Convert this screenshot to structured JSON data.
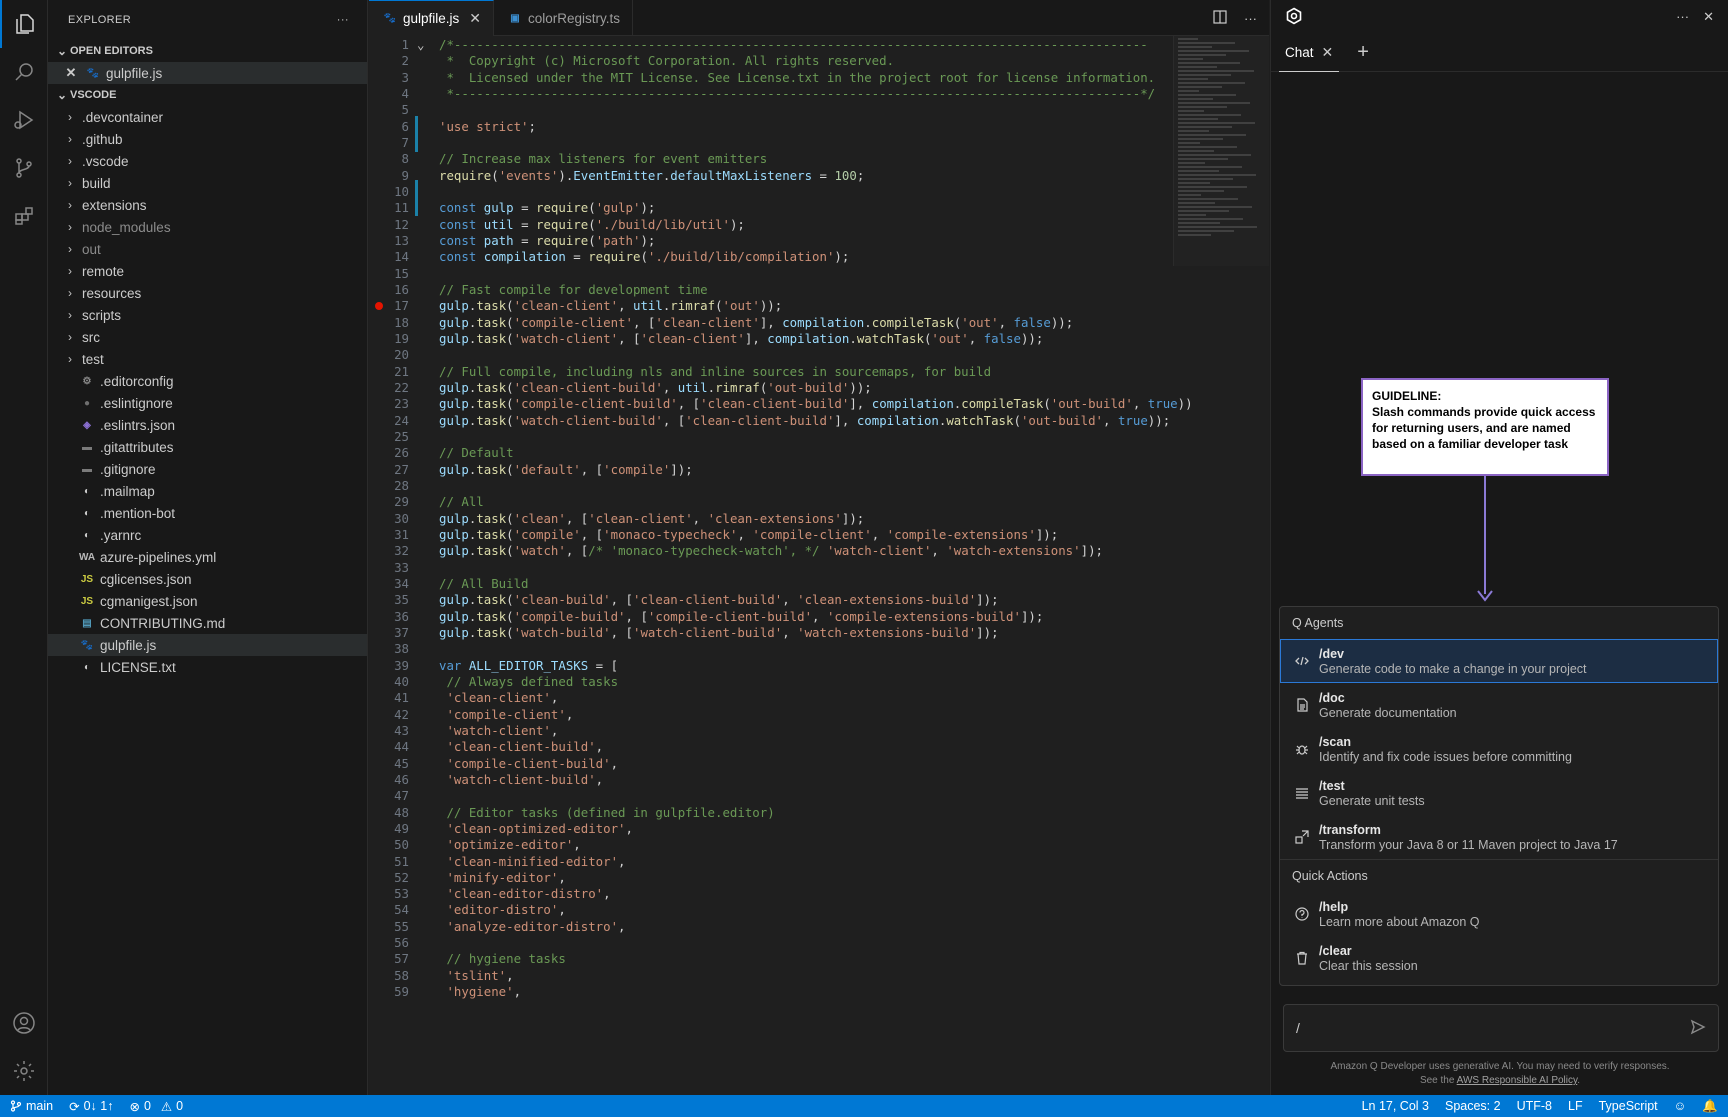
{
  "sidebar": {
    "title": "EXPLORER",
    "more": "···",
    "open_editors_label": "OPEN EDITORS",
    "open_editor_file": "gulpfile.js",
    "workspace_label": "VSCODE",
    "folders": [
      ".devcontainer",
      ".github",
      ".vscode",
      "build",
      "extensions",
      "node_modules",
      "out",
      "remote",
      "resources",
      "scripts",
      "src",
      "test"
    ],
    "files": [
      {
        "name": ".editorconfig",
        "icon": "gear-icon"
      },
      {
        "name": ".eslintignore",
        "icon": "circle-icon"
      },
      {
        "name": ".eslintrs.json",
        "icon": "eslint-icon"
      },
      {
        "name": ".gitattributes",
        "icon": "folder-icon"
      },
      {
        "name": ".gitignore",
        "icon": "folder-icon"
      },
      {
        "name": ".mailmap",
        "icon": "git-icon"
      },
      {
        "name": ".mention-bot",
        "icon": "git-icon"
      },
      {
        "name": ".yarnrc",
        "icon": "git-icon"
      },
      {
        "name": "azure-pipelines.yml",
        "icon": "wa-icon"
      },
      {
        "name": "cglicenses.json",
        "icon": "json-icon"
      },
      {
        "name": "cgmanigest.json",
        "icon": "json-icon"
      },
      {
        "name": "CONTRIBUTING.md",
        "icon": "markdown-icon"
      },
      {
        "name": "gulpfile.js",
        "icon": "gulp-icon"
      },
      {
        "name": "LICENSE.txt",
        "icon": "git-icon"
      }
    ]
  },
  "tabs": [
    {
      "label": "gulpfile.js",
      "active": true
    },
    {
      "label": "colorRegistry.ts",
      "active": false
    }
  ],
  "editor": {
    "lines": [
      [
        [
          "c-com",
          "/*---------------------------------------------------------------------------------------------"
        ]
      ],
      [
        [
          "c-com",
          " *  Copyright (c) Microsoft Corporation. All rights reserved."
        ]
      ],
      [
        [
          "c-com",
          " *  Licensed under the MIT License. See License.txt in the project root for license information."
        ]
      ],
      [
        [
          "c-com",
          " *--------------------------------------------------------------------------------------------*/"
        ]
      ],
      [],
      [
        [
          "c-str",
          "'use strict'"
        ],
        [
          "c-pl",
          ";"
        ]
      ],
      [],
      [
        [
          "c-com",
          "// Increase max listeners for event emitters"
        ]
      ],
      [
        [
          "c-fn",
          "require"
        ],
        [
          "c-pl",
          "("
        ],
        [
          "c-str",
          "'events'"
        ],
        [
          "c-pl",
          ")."
        ],
        [
          "c-id",
          "EventEmitter"
        ],
        [
          "c-pl",
          "."
        ],
        [
          "c-id",
          "defaultMaxListeners"
        ],
        [
          "c-pl",
          " = "
        ],
        [
          "c-num",
          "100"
        ],
        [
          "c-pl",
          ";"
        ]
      ],
      [],
      [
        [
          "c-kw",
          "const "
        ],
        [
          "c-id",
          "gulp"
        ],
        [
          "c-pl",
          " = "
        ],
        [
          "c-fn",
          "require"
        ],
        [
          "c-pl",
          "("
        ],
        [
          "c-str",
          "'gulp'"
        ],
        [
          "c-pl",
          ");"
        ]
      ],
      [
        [
          "c-kw",
          "const "
        ],
        [
          "c-id",
          "util"
        ],
        [
          "c-pl",
          " = "
        ],
        [
          "c-fn",
          "require"
        ],
        [
          "c-pl",
          "("
        ],
        [
          "c-str",
          "'./build/lib/util'"
        ],
        [
          "c-pl",
          ");"
        ]
      ],
      [
        [
          "c-kw",
          "const "
        ],
        [
          "c-id",
          "path"
        ],
        [
          "c-pl",
          " = "
        ],
        [
          "c-fn",
          "require"
        ],
        [
          "c-pl",
          "("
        ],
        [
          "c-str",
          "'path'"
        ],
        [
          "c-pl",
          ");"
        ]
      ],
      [
        [
          "c-kw",
          "const "
        ],
        [
          "c-id",
          "compilation"
        ],
        [
          "c-pl",
          " = "
        ],
        [
          "c-fn",
          "require"
        ],
        [
          "c-pl",
          "("
        ],
        [
          "c-str",
          "'./build/lib/compilation'"
        ],
        [
          "c-pl",
          ");"
        ]
      ],
      [],
      [
        [
          "c-com",
          "// Fast compile for development time"
        ]
      ],
      [
        [
          "c-id",
          "gulp"
        ],
        [
          "c-pl",
          "."
        ],
        [
          "c-fn",
          "task"
        ],
        [
          "c-pl",
          "("
        ],
        [
          "c-str",
          "'clean-client'"
        ],
        [
          "c-pl",
          ", "
        ],
        [
          "c-id",
          "util"
        ],
        [
          "c-pl",
          "."
        ],
        [
          "c-fn",
          "rimraf"
        ],
        [
          "c-pl",
          "("
        ],
        [
          "c-str",
          "'out'"
        ],
        [
          "c-pl",
          "));"
        ]
      ],
      [
        [
          "c-id",
          "gulp"
        ],
        [
          "c-pl",
          "."
        ],
        [
          "c-fn",
          "task"
        ],
        [
          "c-pl",
          "("
        ],
        [
          "c-str",
          "'compile-client'"
        ],
        [
          "c-pl",
          ", ["
        ],
        [
          "c-str",
          "'clean-client'"
        ],
        [
          "c-pl",
          "], "
        ],
        [
          "c-id",
          "compilation"
        ],
        [
          "c-pl",
          "."
        ],
        [
          "c-fn",
          "compileTask"
        ],
        [
          "c-pl",
          "("
        ],
        [
          "c-str",
          "'out'"
        ],
        [
          "c-pl",
          ", "
        ],
        [
          "c-kw",
          "false"
        ],
        [
          "c-pl",
          "));"
        ]
      ],
      [
        [
          "c-id",
          "gulp"
        ],
        [
          "c-pl",
          "."
        ],
        [
          "c-fn",
          "task"
        ],
        [
          "c-pl",
          "("
        ],
        [
          "c-str",
          "'watch-client'"
        ],
        [
          "c-pl",
          ", ["
        ],
        [
          "c-str",
          "'clean-client'"
        ],
        [
          "c-pl",
          "], "
        ],
        [
          "c-id",
          "compilation"
        ],
        [
          "c-pl",
          "."
        ],
        [
          "c-fn",
          "watchTask"
        ],
        [
          "c-pl",
          "("
        ],
        [
          "c-str",
          "'out'"
        ],
        [
          "c-pl",
          ", "
        ],
        [
          "c-kw",
          "false"
        ],
        [
          "c-pl",
          "));"
        ]
      ],
      [],
      [
        [
          "c-com",
          "// Full compile, including nls and inline sources in sourcemaps, for build"
        ]
      ],
      [
        [
          "c-id",
          "gulp"
        ],
        [
          "c-pl",
          "."
        ],
        [
          "c-fn",
          "task"
        ],
        [
          "c-pl",
          "("
        ],
        [
          "c-str",
          "'clean-client-build'"
        ],
        [
          "c-pl",
          ", "
        ],
        [
          "c-id",
          "util"
        ],
        [
          "c-pl",
          "."
        ],
        [
          "c-fn",
          "rimraf"
        ],
        [
          "c-pl",
          "("
        ],
        [
          "c-str",
          "'out-build'"
        ],
        [
          "c-pl",
          "));"
        ]
      ],
      [
        [
          "c-id",
          "gulp"
        ],
        [
          "c-pl",
          "."
        ],
        [
          "c-fn",
          "task"
        ],
        [
          "c-pl",
          "("
        ],
        [
          "c-str",
          "'compile-client-build'"
        ],
        [
          "c-pl",
          ", ["
        ],
        [
          "c-str",
          "'clean-client-build'"
        ],
        [
          "c-pl",
          "], "
        ],
        [
          "c-id",
          "compilation"
        ],
        [
          "c-pl",
          "."
        ],
        [
          "c-fn",
          "compileTask"
        ],
        [
          "c-pl",
          "("
        ],
        [
          "c-str",
          "'out-build'"
        ],
        [
          "c-pl",
          ", "
        ],
        [
          "c-kw",
          "true"
        ],
        [
          "c-pl",
          "))"
        ]
      ],
      [
        [
          "c-id",
          "gulp"
        ],
        [
          "c-pl",
          "."
        ],
        [
          "c-fn",
          "task"
        ],
        [
          "c-pl",
          "("
        ],
        [
          "c-str",
          "'watch-client-build'"
        ],
        [
          "c-pl",
          ", ["
        ],
        [
          "c-str",
          "'clean-client-build'"
        ],
        [
          "c-pl",
          "], "
        ],
        [
          "c-id",
          "compilation"
        ],
        [
          "c-pl",
          "."
        ],
        [
          "c-fn",
          "watchTask"
        ],
        [
          "c-pl",
          "("
        ],
        [
          "c-str",
          "'out-build'"
        ],
        [
          "c-pl",
          ", "
        ],
        [
          "c-kw",
          "true"
        ],
        [
          "c-pl",
          "));"
        ]
      ],
      [],
      [
        [
          "c-com",
          "// Default"
        ]
      ],
      [
        [
          "c-id",
          "gulp"
        ],
        [
          "c-pl",
          "."
        ],
        [
          "c-fn",
          "task"
        ],
        [
          "c-pl",
          "("
        ],
        [
          "c-str",
          "'default'"
        ],
        [
          "c-pl",
          ", ["
        ],
        [
          "c-str",
          "'compile'"
        ],
        [
          "c-pl",
          "]);"
        ]
      ],
      [],
      [
        [
          "c-com",
          "// All"
        ]
      ],
      [
        [
          "c-id",
          "gulp"
        ],
        [
          "c-pl",
          "."
        ],
        [
          "c-fn",
          "task"
        ],
        [
          "c-pl",
          "("
        ],
        [
          "c-str",
          "'clean'"
        ],
        [
          "c-pl",
          ", ["
        ],
        [
          "c-str",
          "'clean-client'"
        ],
        [
          "c-pl",
          ", "
        ],
        [
          "c-str",
          "'clean-extensions'"
        ],
        [
          "c-pl",
          "]);"
        ]
      ],
      [
        [
          "c-id",
          "gulp"
        ],
        [
          "c-pl",
          "."
        ],
        [
          "c-fn",
          "task"
        ],
        [
          "c-pl",
          "("
        ],
        [
          "c-str",
          "'compile'"
        ],
        [
          "c-pl",
          ", ["
        ],
        [
          "c-str",
          "'monaco-typecheck'"
        ],
        [
          "c-pl",
          ", "
        ],
        [
          "c-str",
          "'compile-client'"
        ],
        [
          "c-pl",
          ", "
        ],
        [
          "c-str",
          "'compile-extensions'"
        ],
        [
          "c-pl",
          "]);"
        ]
      ],
      [
        [
          "c-id",
          "gulp"
        ],
        [
          "c-pl",
          "."
        ],
        [
          "c-fn",
          "task"
        ],
        [
          "c-pl",
          "("
        ],
        [
          "c-str",
          "'watch'"
        ],
        [
          "c-pl",
          ", ["
        ],
        [
          "c-com",
          "/* 'monaco-typecheck-watch', */"
        ],
        [
          "c-pl",
          " "
        ],
        [
          "c-str",
          "'watch-client'"
        ],
        [
          "c-pl",
          ", "
        ],
        [
          "c-str",
          "'watch-extensions'"
        ],
        [
          "c-pl",
          "]);"
        ]
      ],
      [],
      [
        [
          "c-com",
          "// All Build"
        ]
      ],
      [
        [
          "c-id",
          "gulp"
        ],
        [
          "c-pl",
          "."
        ],
        [
          "c-fn",
          "task"
        ],
        [
          "c-pl",
          "("
        ],
        [
          "c-str",
          "'clean-build'"
        ],
        [
          "c-pl",
          ", ["
        ],
        [
          "c-str",
          "'clean-client-build'"
        ],
        [
          "c-pl",
          ", "
        ],
        [
          "c-str",
          "'clean-extensions-build'"
        ],
        [
          "c-pl",
          "]);"
        ]
      ],
      [
        [
          "c-id",
          "gulp"
        ],
        [
          "c-pl",
          "."
        ],
        [
          "c-fn",
          "task"
        ],
        [
          "c-pl",
          "("
        ],
        [
          "c-str",
          "'compile-build'"
        ],
        [
          "c-pl",
          ", ["
        ],
        [
          "c-str",
          "'compile-client-build'"
        ],
        [
          "c-pl",
          ", "
        ],
        [
          "c-str",
          "'compile-extensions-build'"
        ],
        [
          "c-pl",
          "]);"
        ]
      ],
      [
        [
          "c-id",
          "gulp"
        ],
        [
          "c-pl",
          "."
        ],
        [
          "c-fn",
          "task"
        ],
        [
          "c-pl",
          "("
        ],
        [
          "c-str",
          "'watch-build'"
        ],
        [
          "c-pl",
          ", ["
        ],
        [
          "c-str",
          "'watch-client-build'"
        ],
        [
          "c-pl",
          ", "
        ],
        [
          "c-str",
          "'watch-extensions-build'"
        ],
        [
          "c-pl",
          "]);"
        ]
      ],
      [],
      [
        [
          "c-kw",
          "var "
        ],
        [
          "c-id",
          "ALL_EDITOR_TASKS"
        ],
        [
          "c-pl",
          " = ["
        ]
      ],
      [
        [
          "c-com",
          " // Always defined tasks"
        ]
      ],
      [
        [
          "c-str",
          " 'clean-client'"
        ],
        [
          "c-pl",
          ","
        ]
      ],
      [
        [
          "c-str",
          " 'compile-client'"
        ],
        [
          "c-pl",
          ","
        ]
      ],
      [
        [
          "c-str",
          " 'watch-client'"
        ],
        [
          "c-pl",
          ","
        ]
      ],
      [
        [
          "c-str",
          " 'clean-client-build'"
        ],
        [
          "c-pl",
          ","
        ]
      ],
      [
        [
          "c-str",
          " 'compile-client-build'"
        ],
        [
          "c-pl",
          ","
        ]
      ],
      [
        [
          "c-str",
          " 'watch-client-build'"
        ],
        [
          "c-pl",
          ","
        ]
      ],
      [],
      [
        [
          "c-com",
          " // Editor tasks (defined in gulpfile.editor)"
        ]
      ],
      [
        [
          "c-str",
          " 'clean-optimized-editor'"
        ],
        [
          "c-pl",
          ","
        ]
      ],
      [
        [
          "c-str",
          " 'optimize-editor'"
        ],
        [
          "c-pl",
          ","
        ]
      ],
      [
        [
          "c-str",
          " 'clean-minified-editor'"
        ],
        [
          "c-pl",
          ","
        ]
      ],
      [
        [
          "c-str",
          " 'minify-editor'"
        ],
        [
          "c-pl",
          ","
        ]
      ],
      [
        [
          "c-str",
          " 'clean-editor-distro'"
        ],
        [
          "c-pl",
          ","
        ]
      ],
      [
        [
          "c-str",
          " 'editor-distro'"
        ],
        [
          "c-pl",
          ","
        ]
      ],
      [
        [
          "c-str",
          " 'analyze-editor-distro'"
        ],
        [
          "c-pl",
          ","
        ]
      ],
      [],
      [
        [
          "c-com",
          " // hygiene tasks"
        ]
      ],
      [
        [
          "c-str",
          " 'tslint'"
        ],
        [
          "c-pl",
          ","
        ]
      ],
      [
        [
          "c-str",
          " 'hygiene'"
        ],
        [
          "c-pl",
          ","
        ]
      ]
    ]
  },
  "chat": {
    "tab_label": "Chat",
    "plus": "+",
    "more": "···",
    "guideline_title": "GUIDELINE:",
    "guideline_text": "Slash commands provide quick access for returning users, and are named based on a familiar developer task",
    "agents_label": "Q Agents",
    "agents": [
      {
        "cmd": "/dev",
        "desc": "Generate code to make a change in your project",
        "icon": "code-icon"
      },
      {
        "cmd": "/doc",
        "desc": "Generate documentation",
        "icon": "document-icon"
      },
      {
        "cmd": "/scan",
        "desc": "Identify and fix code issues before committing",
        "icon": "bug-icon"
      },
      {
        "cmd": "/test",
        "desc": "Generate unit tests",
        "icon": "list-icon"
      },
      {
        "cmd": "/transform",
        "desc": "Transform your Java 8 or 11 Maven project to Java 17",
        "icon": "transform-icon"
      }
    ],
    "quick_label": "Quick Actions",
    "quick": [
      {
        "cmd": "/help",
        "desc": "Learn more about Amazon Q",
        "icon": "help-icon"
      },
      {
        "cmd": "/clear",
        "desc": "Clear this session",
        "icon": "trash-icon"
      }
    ],
    "input_value": "/",
    "footer_line1": "Amazon Q Developer uses generative AI. You may need to verify responses.",
    "footer_see": "See the ",
    "footer_link": "AWS Responsible AI Policy",
    "footer_end": "."
  },
  "status": {
    "branch": "main",
    "sync": "0↓ 1↑",
    "errors": "0",
    "warnings": "0",
    "position": "Ln 17, Col 3",
    "spaces": "Spaces: 2",
    "encoding": "UTF-8",
    "eol": "LF",
    "language": "TypeScript"
  },
  "colors": {
    "accent": "#0078d4",
    "guideline_border": "#8b64c4"
  }
}
